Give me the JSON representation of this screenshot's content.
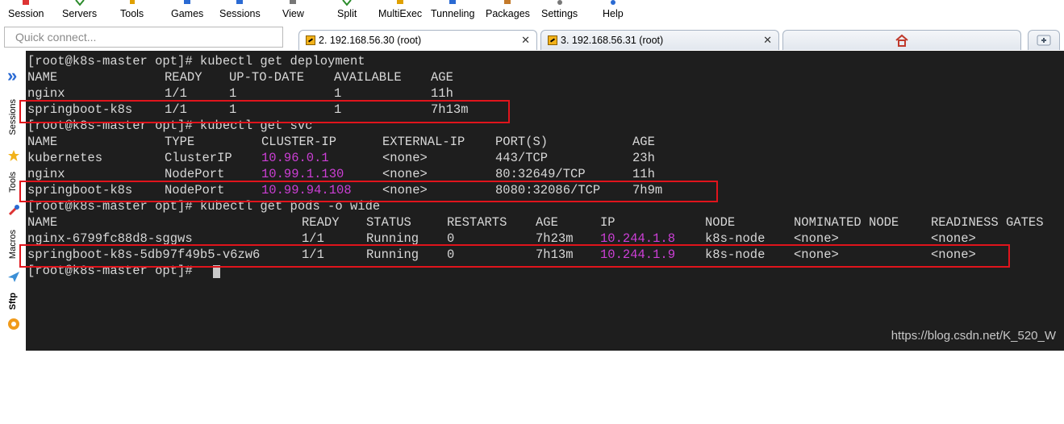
{
  "menu": [
    {
      "label": "Session",
      "icon": "session-icon",
      "color": "#d33"
    },
    {
      "label": "Servers",
      "icon": "servers-icon",
      "color": "#2a8a2a"
    },
    {
      "label": "Tools",
      "icon": "tools-icon",
      "color": "#e0a000"
    },
    {
      "label": "Games",
      "icon": "games-icon",
      "color": "#2a6ad3"
    },
    {
      "label": "Sessions",
      "icon": "sessions-icon",
      "color": "#2a6ad3"
    },
    {
      "label": "View",
      "icon": "view-icon",
      "color": "#555"
    },
    {
      "label": "Split",
      "icon": "split-icon",
      "color": "#2a8a2a"
    },
    {
      "label": "MultiExec",
      "icon": "multiexec-icon",
      "color": "#e0a000"
    },
    {
      "label": "Tunneling",
      "icon": "tunneling-icon",
      "color": "#2a6ad3"
    },
    {
      "label": "Packages",
      "icon": "packages-icon",
      "color": "#c47a2a"
    },
    {
      "label": "Settings",
      "icon": "settings-icon",
      "color": "#555"
    },
    {
      "label": "Help",
      "icon": "help-icon",
      "color": "#2a6ad3"
    }
  ],
  "quick_connect": {
    "placeholder": "Quick connect..."
  },
  "tabs": [
    {
      "label": "2. 192.168.56.30 (root)",
      "active": true
    },
    {
      "label": "3. 192.168.56.31 (root)",
      "active": false
    }
  ],
  "sidebar": {
    "sessions": "Sessions",
    "tools": "Tools",
    "macros": "Macros",
    "sftp": "Sftp",
    "expand_glyph": "»"
  },
  "terminal": {
    "lines": [
      [
        "[root@k8s-master opt]# kubectl get deployment"
      ],
      [
        "NAME",
        "READY",
        "UP-TO-DATE",
        "AVAILABLE",
        "AGE"
      ],
      [
        "nginx",
        "1/1",
        "1",
        "1",
        "11h"
      ],
      [
        "springboot-k8s",
        "1/1",
        "1",
        "1",
        "7h13m"
      ],
      [
        "[root@k8s-master opt]# kubectl get svc"
      ],
      [
        "NAME",
        "TYPE",
        "CLUSTER-IP",
        "EXTERNAL-IP",
        "PORT(S)",
        "AGE"
      ],
      [
        "kubernetes",
        "ClusterIP",
        "10.96.0.1",
        "<none>",
        "443/TCP",
        "23h"
      ],
      [
        "nginx",
        "NodePort",
        "10.99.1.130",
        "<none>",
        "80:32649/TCP",
        "11h"
      ],
      [
        "springboot-k8s",
        "NodePort",
        "10.99.94.108",
        "<none>",
        "8080:32086/TCP",
        "7h9m"
      ],
      [
        "[root@k8s-master opt]# kubectl get pods -o wide"
      ],
      [
        "NAME",
        "READY",
        "STATUS",
        "RESTARTS",
        "AGE",
        "IP",
        "NODE",
        "NOMINATED NODE",
        "READINESS GATES"
      ],
      [
        "nginx-6799fc88d8-sggws",
        "1/1",
        "Running",
        "0",
        "7h23m",
        "10.244.1.8",
        "k8s-node",
        "<none>",
        "<none>"
      ],
      [
        "springboot-k8s-5db97f49b5-v6zw6",
        "1/1",
        "Running",
        "0",
        "7h13m",
        "10.244.1.9",
        "k8s-node",
        "<none>",
        "<none>"
      ],
      [
        "[root@k8s-master opt]# "
      ]
    ],
    "accent_magenta": "#cc3fd6",
    "highlight_color": "#e0141c"
  },
  "watermark": "https://blog.csdn.net/K_520_W"
}
